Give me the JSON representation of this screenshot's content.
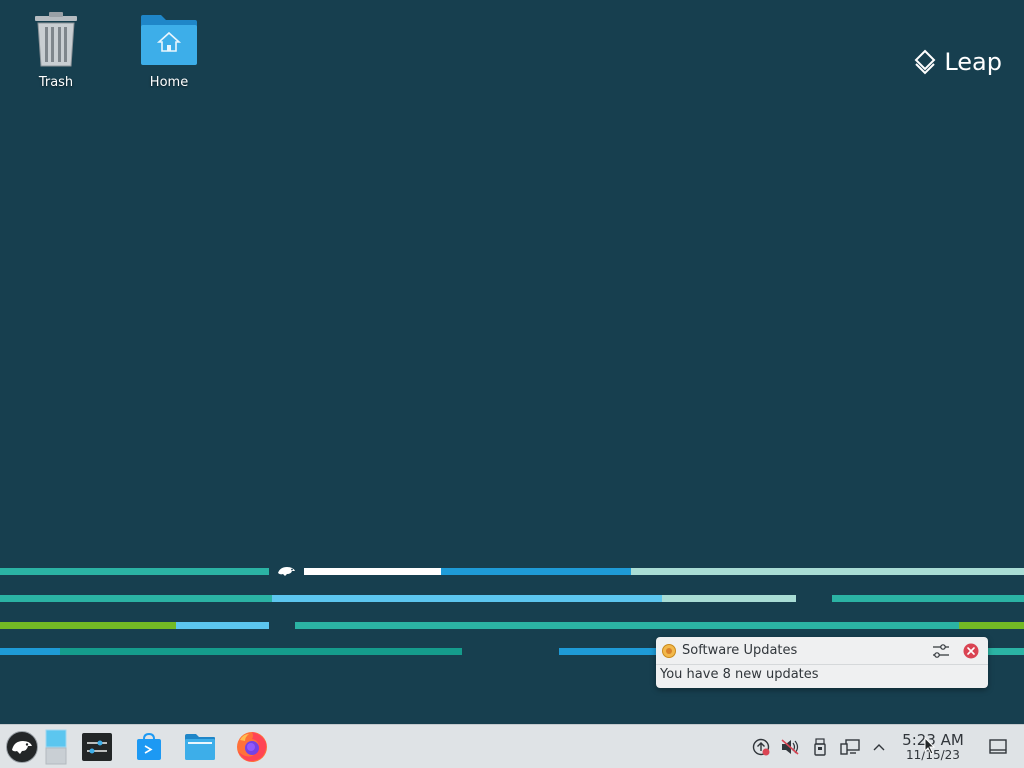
{
  "desktop": {
    "icons": [
      {
        "id": "trash",
        "label": "Trash"
      },
      {
        "id": "home",
        "label": "Home"
      }
    ],
    "logo_text": "Leap"
  },
  "wallpaper": {
    "colors": {
      "teal": "#2bb3a4",
      "blue": "#1e9bd7",
      "light_blue": "#5cc6ef",
      "pale": "#a9ddd5",
      "white": "#ffffff",
      "green": "#73ba25",
      "dark_teal": "#159c8c"
    }
  },
  "notification": {
    "app_icon": "software-updates-icon",
    "title": "Software Updates",
    "body": "You have 8 new updates",
    "configure_icon": "settings-sliders-icon",
    "close_icon": "close-icon"
  },
  "taskbar": {
    "launchers": [
      {
        "name": "application-launcher",
        "icon": "opensuse-chameleon-icon"
      },
      {
        "name": "pager",
        "icon": "virtual-desktop-pager-icon"
      },
      {
        "name": "system-settings",
        "icon": "system-settings-icon"
      },
      {
        "name": "discover",
        "icon": "discover-store-icon"
      },
      {
        "name": "dolphin",
        "icon": "file-manager-icon"
      },
      {
        "name": "firefox",
        "icon": "firefox-icon"
      }
    ],
    "tray": [
      {
        "name": "updates",
        "icon": "updates-available-icon"
      },
      {
        "name": "volume",
        "icon": "volume-muted-icon"
      },
      {
        "name": "removable-devices",
        "icon": "usb-device-icon"
      },
      {
        "name": "network",
        "icon": "network-wired-icon"
      },
      {
        "name": "expand",
        "icon": "chevron-up-icon"
      }
    ],
    "clock": {
      "time": "5:23 AM",
      "date": "11/15/23"
    },
    "show_desktop_icon": "show-desktop-icon"
  }
}
